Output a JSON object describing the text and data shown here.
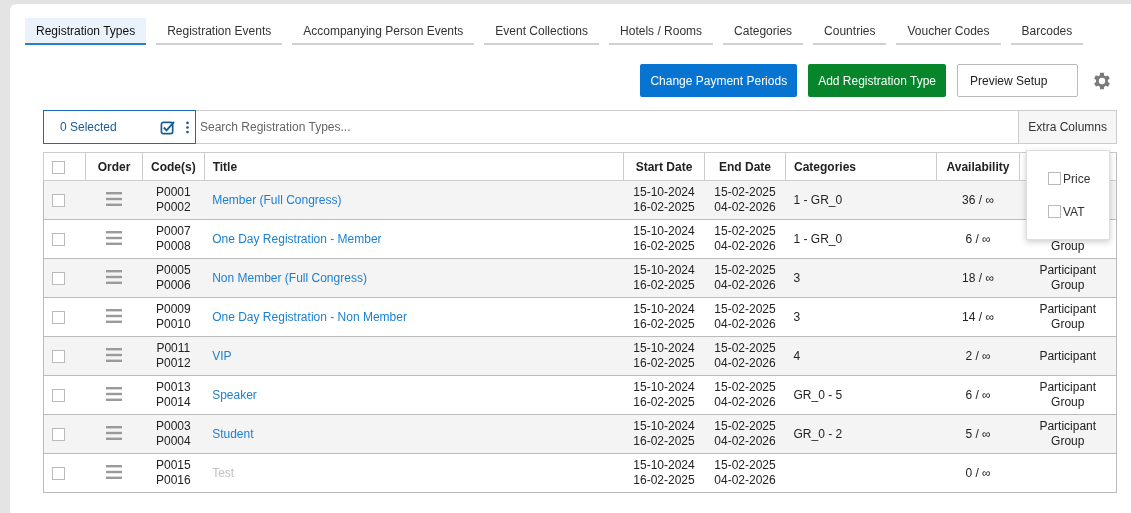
{
  "tabs": [
    {
      "label": "Registration Types",
      "selected": true
    },
    {
      "label": "Registration Events",
      "selected": false
    },
    {
      "label": "Accompanying Person Events",
      "selected": false
    },
    {
      "label": "Event Collections",
      "selected": false
    },
    {
      "label": "Hotels / Rooms",
      "selected": false
    },
    {
      "label": "Categories",
      "selected": false
    },
    {
      "label": "Countries",
      "selected": false
    },
    {
      "label": "Voucher Codes",
      "selected": false
    },
    {
      "label": "Barcodes",
      "selected": false
    }
  ],
  "actions": [
    {
      "label": "Change Payment Periods",
      "kind": "primary"
    },
    {
      "label": "Add Registration Type",
      "kind": "success"
    },
    {
      "label": "Preview Setup",
      "kind": "outline"
    }
  ],
  "toolbar": {
    "selected_count": "0 Selected",
    "search": {
      "placeholder": "Search Registration Types..."
    },
    "extra_columns": "Extra Columns"
  },
  "extra_columns_menu": [
    {
      "label": "Price",
      "checked": false
    },
    {
      "label": "VAT",
      "checked": false
    }
  ],
  "table": {
    "select_all_checked": false,
    "columns": [
      "Order",
      "Code(s)",
      "Title",
      "Start Date",
      "End Date",
      "Categories",
      "Availability"
    ],
    "rows": [
      {
        "checked": false,
        "codes": [
          "P0001",
          "P0002"
        ],
        "title": "Member (Full Congress)",
        "disabled": false,
        "start": [
          "15-10-2024",
          "16-02-2025"
        ],
        "end": [
          "15-02-2025",
          "04-02-2026"
        ],
        "categories": "1 - GR_0",
        "availability": "36 / ∞"
      },
      {
        "checked": false,
        "codes": [
          "P0007",
          "P0008"
        ],
        "title": "One Day Registration - Member",
        "disabled": false,
        "start": [
          "15-10-2024",
          "16-02-2025"
        ],
        "end": [
          "15-02-2025",
          "04-02-2026"
        ],
        "categories": "1 - GR_0",
        "availability": "6 / ∞",
        "column_9": {
          "lines": [
            "Group"
          ],
          "top_covered": true
        }
      },
      {
        "checked": false,
        "codes": [
          "P0005",
          "P0006"
        ],
        "title": "Non Member (Full Congress)",
        "disabled": false,
        "start": [
          "15-10-2024",
          "16-02-2025"
        ],
        "end": [
          "15-02-2025",
          "04-02-2026"
        ],
        "categories": "3",
        "availability": "18 / ∞",
        "column_9": {
          "lines": [
            "Participant",
            "Group"
          ],
          "top_covered": false
        }
      },
      {
        "checked": false,
        "codes": [
          "P0009",
          "P0010"
        ],
        "title": "One Day Registration - Non Member",
        "disabled": false,
        "start": [
          "15-10-2024",
          "16-02-2025"
        ],
        "end": [
          "15-02-2025",
          "04-02-2026"
        ],
        "categories": "3",
        "availability": "14 / ∞",
        "column_9": {
          "lines": [
            "Participant",
            "Group"
          ],
          "top_covered": false
        }
      },
      {
        "checked": false,
        "codes": [
          "P0011",
          "P0012"
        ],
        "title": "VIP",
        "disabled": false,
        "start": [
          "15-10-2024",
          "16-02-2025"
        ],
        "end": [
          "15-02-2025",
          "04-02-2026"
        ],
        "categories": "4",
        "availability": "2 / ∞",
        "column_9": {
          "lines": [
            "Participant"
          ],
          "top_covered": false
        }
      },
      {
        "checked": false,
        "codes": [
          "P0013",
          "P0014"
        ],
        "title": "Speaker",
        "disabled": false,
        "start": [
          "15-10-2024",
          "16-02-2025"
        ],
        "end": [
          "15-02-2025",
          "04-02-2026"
        ],
        "categories": "GR_0 - 5",
        "availability": "6 / ∞",
        "column_9": {
          "lines": [
            "Participant",
            "Group"
          ],
          "top_covered": false
        }
      },
      {
        "checked": false,
        "codes": [
          "P0003",
          "P0004"
        ],
        "title": "Student",
        "disabled": false,
        "start": [
          "15-10-2024",
          "16-02-2025"
        ],
        "end": [
          "15-02-2025",
          "04-02-2026"
        ],
        "categories": "GR_0 - 2",
        "availability": "5 / ∞",
        "column_9": {
          "lines": [
            "Participant",
            "Group"
          ],
          "top_covered": false
        }
      },
      {
        "checked": false,
        "codes": [
          "P0015",
          "P0016"
        ],
        "title": "Test",
        "disabled": true,
        "start": [
          "15-10-2024",
          "16-02-2025"
        ],
        "end": [
          "15-02-2025",
          "04-02-2026"
        ],
        "availability": "0 / ∞"
      }
    ]
  }
}
